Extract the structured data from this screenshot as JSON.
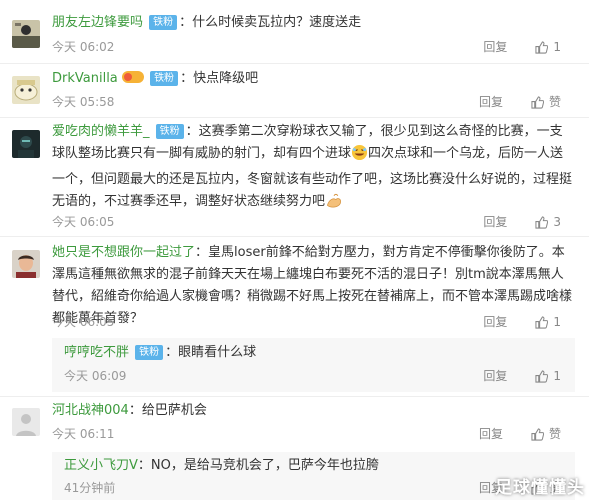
{
  "comments": [
    {
      "username": "朋友左边锋要吗",
      "badge": "铁粉",
      "text": "什么时候卖瓦拉内？速度送走",
      "time": "今天 06:02",
      "reply": "回复",
      "likes": "1"
    },
    {
      "username": "DrkVanilla",
      "level": "6",
      "badge": "铁粉",
      "text": "快点降级吧",
      "time": "今天 05:58",
      "reply": "回复",
      "likes": "赞"
    },
    {
      "username": "爱吃肉的懒羊羊_",
      "badge": "铁粉",
      "text_before_emoji": "这赛季第二次穿粉球衣又输了，很少见到这么奇怪的比赛，一支球队整场比赛只有一脚有威胁的射门，却有四个进球",
      "text_after_emoji": "四次点球和一个乌龙，后防一人送一个，但问题最大的还是瓦拉内，冬窗就该有些动作了吧，这场比赛没什么好说的，过程挺无语的，不过赛季还早，调整好状态继续努力吧",
      "time": "今天 06:05",
      "reply": "回复",
      "likes": "3"
    },
    {
      "username": "她只是不想跟你一起过了",
      "text": "皇馬loser前鋒不給對方壓力，對方肯定不停衝擊你後防了。本澤馬這種無欲無求的混子前鋒天天在場上纏塊白布要死不活的混日子！別tm說本澤馬無人替代，紹維奇你給過人家機會嗎？稍微踢不好馬上按死在替補席上，而不管本澤馬踢成啥樣都能萬年首發？",
      "time": "今天 06:05",
      "reply": "回复",
      "likes": "1"
    },
    {
      "username": "哼哼吃不胖",
      "badge": "铁粉",
      "text": "眼睛看什么球",
      "time": "今天 06:09",
      "reply": "回复",
      "likes": "1"
    },
    {
      "username": "河北战神004",
      "text": "给巴萨机会",
      "time": "今天 06:11",
      "reply": "回复",
      "likes": "赞"
    },
    {
      "username": "正义小飞刀V",
      "text": "NO，是给马竞机会了，巴萨今年也拉胯",
      "time": "41分钟前",
      "reply": "回复",
      "likes": "赞"
    }
  ],
  "watermark": "足球懂懂头",
  "colors": {
    "username": "#3d9a3d",
    "badge": "#5bb3ea",
    "meta": "#999999"
  }
}
